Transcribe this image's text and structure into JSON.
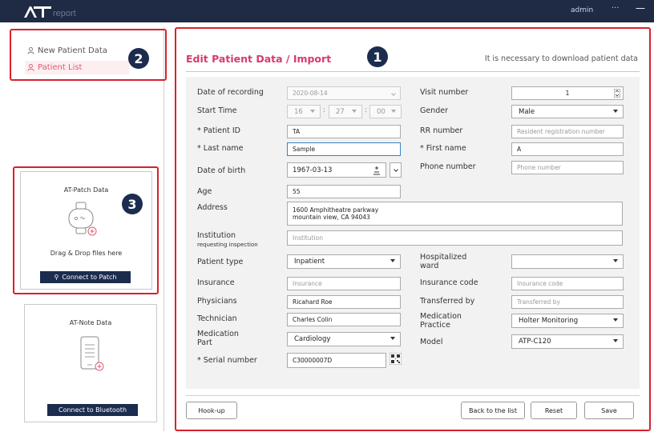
{
  "app": {
    "logo_text": "report",
    "user": "admin",
    "dots": "···",
    "minimize": "—"
  },
  "sidebar": {
    "items": [
      {
        "label": "New Patient Data",
        "icon": "person-icon"
      },
      {
        "label": "Patient List",
        "icon": "person-icon"
      }
    ],
    "patch_card": {
      "title": "AT-Patch Data",
      "drop_text": "Drag & Drop files here",
      "button": "Connect to Patch",
      "button_icon": "usb-icon"
    },
    "note_card": {
      "title": "AT-Note Data",
      "button": "Connect to Bluetooth"
    }
  },
  "badges": {
    "main": "1",
    "nav": "2",
    "patch": "3"
  },
  "form": {
    "title": "Edit Patient Data / Import",
    "hint": "It is necessary to download patient data",
    "date_of_recording": {
      "label": "Date of recording",
      "value": "2020-08-14"
    },
    "start_time": {
      "label": "Start Time",
      "hour": "16",
      "minute": "27",
      "second": "00",
      "sep": ":"
    },
    "patient_id": {
      "label": "* Patient ID",
      "value": "TA"
    },
    "last_name": {
      "label": "* Last name",
      "value": "Sample"
    },
    "date_of_birth": {
      "label": "Date of birth",
      "value": "1967-03-13"
    },
    "age": {
      "label": "Age",
      "value": "55"
    },
    "address": {
      "label": "Address",
      "line1": "1600 Amphitheatre parkway",
      "line2": "mountain view, CA 94043"
    },
    "institution": {
      "label": "Institution",
      "sublabel": "requesting inspection",
      "placeholder": "Institution"
    },
    "patient_type": {
      "label": "Patient type",
      "value": "Inpatient"
    },
    "insurance": {
      "label": "Insurance",
      "placeholder": "Insurance"
    },
    "physicians": {
      "label": "Physicians",
      "value": "Ricahard Roe"
    },
    "technician": {
      "label": "Technician",
      "value": "Charles Colin"
    },
    "medication_part": {
      "label1": "Medication",
      "label2": "Part",
      "value": "Cardiology"
    },
    "serial_number": {
      "label": "* Serial number",
      "value": "C30000007D"
    },
    "visit_number": {
      "label": "Visit number",
      "value": "1"
    },
    "gender": {
      "label": "Gender",
      "value": "Male"
    },
    "rr_number": {
      "label": "RR number",
      "placeholder": "Resident registration number"
    },
    "first_name": {
      "label": "* First name",
      "value": "A"
    },
    "phone_number": {
      "label": "Phone number",
      "placeholder": "Phone number"
    },
    "hospitalized_ward": {
      "label1": "Hospitalized",
      "label2": "ward",
      "value": ""
    },
    "insurance_code": {
      "label": "Insurance code",
      "placeholder": "Insurance code"
    },
    "transferred_by": {
      "label": "Transferred by",
      "placeholder": "Transferred by"
    },
    "medication_practice": {
      "label1": "Medication",
      "label2": "Practice",
      "value": "Holter Monitoring"
    },
    "model": {
      "label": "Model",
      "value": "ATP-C120"
    }
  },
  "buttons": {
    "hookup": "Hook-up",
    "back": "Back to the list",
    "reset": "Reset",
    "save": "Save"
  },
  "colors": {
    "titlebar": "#1f2a44",
    "accent": "#d83a6a",
    "highlight": "#d9202e",
    "badge": "#1c2c4e"
  }
}
